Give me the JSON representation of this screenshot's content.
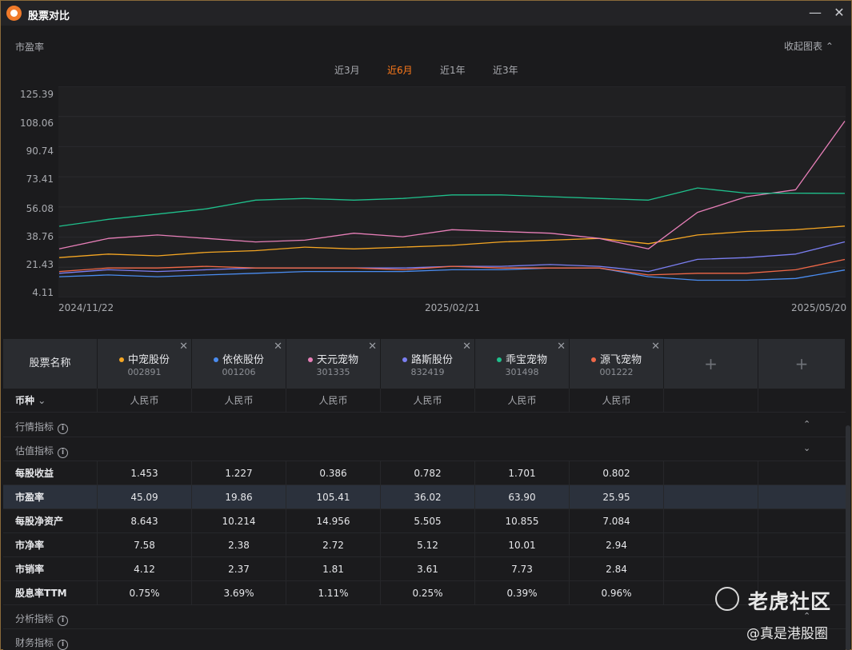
{
  "window": {
    "title": "股票对比",
    "minimize_glyph": "—",
    "close_glyph": "✕"
  },
  "chart": {
    "metric_label": "市盈率",
    "collapse_label": "收起图表",
    "periods": [
      {
        "label": "近3月",
        "active": false
      },
      {
        "label": "近6月",
        "active": true
      },
      {
        "label": "近1年",
        "active": false
      },
      {
        "label": "近3年",
        "active": false
      }
    ]
  },
  "chart_data": {
    "type": "line",
    "title": "",
    "xlabel": "",
    "ylabel": "",
    "ylim": [
      4.11,
      125.39
    ],
    "y_ticks": [
      "125.39",
      "108.06",
      "90.74",
      "73.41",
      "56.08",
      "38.76",
      "21.43",
      "4.11"
    ],
    "x_ticks": [
      "2024/11/22",
      "2025/02/21",
      "2025/05/20"
    ],
    "x": [
      "2024/11/22",
      "2024/12/06",
      "2024/12/20",
      "2025/01/03",
      "2025/01/17",
      "2025/01/31",
      "2025/02/14",
      "2025/02/21",
      "2025/03/07",
      "2025/03/21",
      "2025/04/04",
      "2025/04/18",
      "2025/04/25",
      "2025/05/02",
      "2025/05/09",
      "2025/05/16",
      "2025/05/20"
    ],
    "series": [
      {
        "name": "中宠股份",
        "color": "#f5a623",
        "values": [
          27,
          29,
          28,
          30,
          31,
          33,
          32,
          33,
          34,
          36,
          37,
          38,
          35,
          40,
          42,
          43,
          45.09
        ]
      },
      {
        "name": "依依股份",
        "color": "#4a8cf0",
        "values": [
          16,
          17,
          16,
          17,
          18,
          19,
          19,
          19,
          20,
          20,
          21,
          21,
          16,
          14,
          14,
          15,
          19.86
        ]
      },
      {
        "name": "天元宠物",
        "color": "#e77fb8",
        "values": [
          32,
          38,
          40,
          38,
          36,
          37,
          41,
          39,
          43,
          42,
          41,
          38,
          32,
          53,
          62,
          66,
          105.41
        ]
      },
      {
        "name": "路斯股份",
        "color": "#7b7ff2",
        "values": [
          18,
          20,
          19,
          20,
          21,
          21,
          21,
          21,
          22,
          22,
          23,
          22,
          19,
          26,
          27,
          29,
          36.02
        ]
      },
      {
        "name": "乖宝宠物",
        "color": "#1fc08c",
        "values": [
          45,
          49,
          52,
          55,
          60,
          61,
          60,
          61,
          63,
          63,
          62,
          61,
          60,
          67,
          64,
          64,
          63.9
        ]
      },
      {
        "name": "源飞宠物",
        "color": "#f06848",
        "values": [
          19,
          21,
          21,
          22,
          21,
          21,
          21,
          20,
          22,
          21,
          21,
          21,
          17,
          18,
          18,
          20,
          25.95
        ]
      }
    ]
  },
  "table": {
    "header_label": "股票名称",
    "remove_glyph": "✕",
    "add_glyph": "+",
    "stocks": [
      {
        "name": "中宠股份",
        "code": "002891",
        "color": "#f5a623"
      },
      {
        "name": "依依股份",
        "code": "001206",
        "color": "#4a8cf0"
      },
      {
        "name": "天元宠物",
        "code": "301335",
        "color": "#e77fb8"
      },
      {
        "name": "路斯股份",
        "code": "832419",
        "color": "#7b7ff2"
      },
      {
        "name": "乖宝宠物",
        "code": "301498",
        "color": "#1fc08c"
      },
      {
        "name": "源飞宠物",
        "code": "001222",
        "color": "#f06848"
      }
    ],
    "currency_row": {
      "label": "币种",
      "values": [
        "人民币",
        "人民币",
        "人民币",
        "人民币",
        "人民币",
        "人民币"
      ]
    },
    "sections": {
      "market": "行情指标",
      "valuation": "估值指标",
      "analysis": "分析指标",
      "financial": "财务指标"
    },
    "metrics": [
      {
        "label": "每股收益",
        "values": [
          "1.453",
          "1.227",
          "0.386",
          "0.782",
          "1.701",
          "0.802"
        ],
        "highlighted": false
      },
      {
        "label": "市盈率",
        "values": [
          "45.09",
          "19.86",
          "105.41",
          "36.02",
          "63.90",
          "25.95"
        ],
        "highlighted": true
      },
      {
        "label": "每股净资产",
        "values": [
          "8.643",
          "10.214",
          "14.956",
          "5.505",
          "10.855",
          "7.084"
        ],
        "highlighted": false
      },
      {
        "label": "市净率",
        "values": [
          "7.58",
          "2.38",
          "2.72",
          "5.12",
          "10.01",
          "2.94"
        ],
        "highlighted": false
      },
      {
        "label": "市销率",
        "values": [
          "4.12",
          "2.37",
          "1.81",
          "3.61",
          "7.73",
          "2.84"
        ],
        "highlighted": false
      },
      {
        "label": "股息率TTM",
        "values": [
          "0.75%",
          "3.69%",
          "1.11%",
          "0.25%",
          "0.39%",
          "0.96%"
        ],
        "highlighted": false
      }
    ]
  },
  "watermark": {
    "brand": "老虎社区",
    "handle": "@真是港股圈"
  }
}
